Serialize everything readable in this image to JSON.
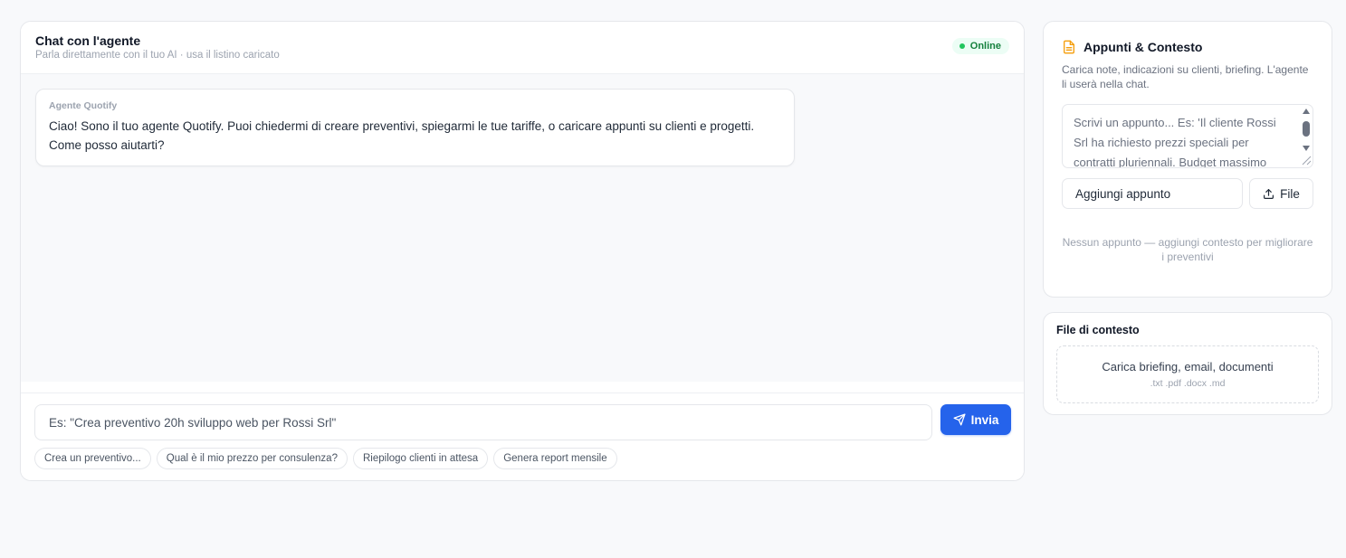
{
  "chat": {
    "title": "Chat con l'agente",
    "subtitle": "Parla direttamente con il tuo AI · usa il listino caricato",
    "status": "Online",
    "messages": [
      {
        "author": "Agente Quotify",
        "text": "Ciao! Sono il tuo agente Quotify. Puoi chiedermi di creare preventivi, spiegarmi le tue tariffe, o caricare appunti su clienti e progetti. Come posso aiutarti?"
      }
    ],
    "input_placeholder": "Es: \"Crea preventivo 20h sviluppo web per Rossi Srl\"",
    "send_label": "Invia",
    "suggestions": [
      "Crea un preventivo...",
      "Qual è il mio prezzo per consulenza?",
      "Riepilogo clienti in attesa",
      "Genera report mensile"
    ]
  },
  "notes": {
    "title": "Appunti & Contesto",
    "description": "Carica note, indicazioni su clienti, briefing. L'agente li userà nella chat.",
    "textarea_placeholder": "Scrivi un appunto... Es: 'Il cliente Rossi Srl ha richiesto prezzi speciali per contratti pluriennali. Budget massimo",
    "add_label": "Aggiungi appunto",
    "file_label": "File",
    "empty_text": "Nessun appunto — aggiungi contesto per migliorare i preventivi"
  },
  "context_files": {
    "title": "File di contesto",
    "dropzone_title": "Carica briefing, email, documenti",
    "dropzone_formats": ".txt .pdf .docx .md"
  },
  "colors": {
    "accent": "#2563eb",
    "online": "#22c55e",
    "notes_icon": "#f59e0b"
  },
  "icons": {
    "send": "send-icon",
    "notes": "document-icon",
    "upload": "upload-icon"
  }
}
